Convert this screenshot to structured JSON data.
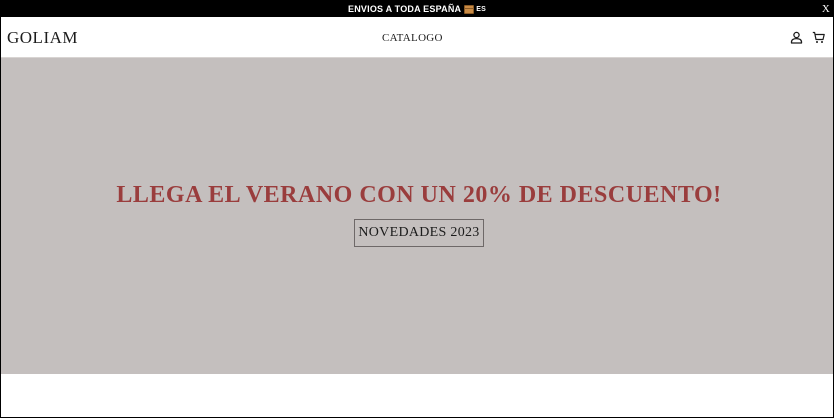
{
  "announcement": {
    "text": "ENVIOS A TODA ESPAÑA",
    "icon": "package-icon",
    "lang": "ES",
    "close_label": "X"
  },
  "header": {
    "logo": "GOLIAM",
    "nav": {
      "catalog_label": "CATALOGO"
    },
    "icons": [
      "account-icon",
      "cart-icon"
    ]
  },
  "hero": {
    "title": "LLEGA EL VERANO CON UN 20% DE DESCUENTO!",
    "button_label": "NOVEDADES 2023",
    "background_color": "#c4bfbe",
    "title_color": "#9a3d3d"
  }
}
